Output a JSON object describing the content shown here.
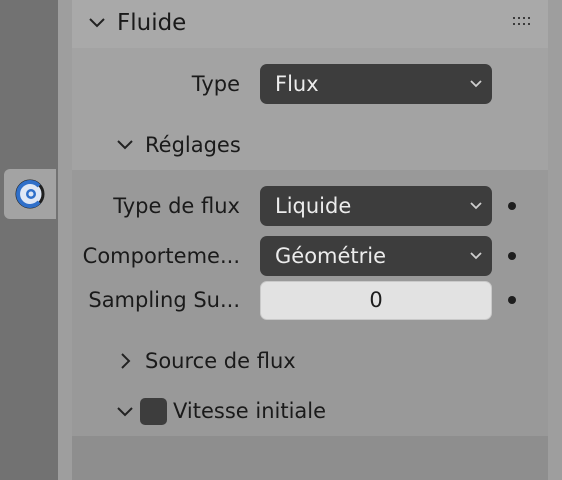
{
  "panel": {
    "title": "Fluide",
    "drag_handle_icon": "grip-dots-icon",
    "type_label": "Type",
    "type_value": "Flux"
  },
  "settings": {
    "title": "Réglages",
    "flow_type_label": "Type de flux",
    "flow_type_value": "Liquide",
    "behavior_label": "Comporteme...",
    "behavior_value": "Géométrie",
    "sampling_label": "Sampling Su...",
    "sampling_value": "0"
  },
  "subpanels": {
    "flow_source_label": "Source de flux",
    "initial_velocity_label": "Vitesse initiale"
  },
  "sidebar": {
    "active_tab_icon": "fluid-physics-icon"
  },
  "colors": {
    "active_tab_icon": "#2f6fc9",
    "dropdown_bg": "#3d3d3d",
    "number_field_bg": "#e2e2e2"
  }
}
